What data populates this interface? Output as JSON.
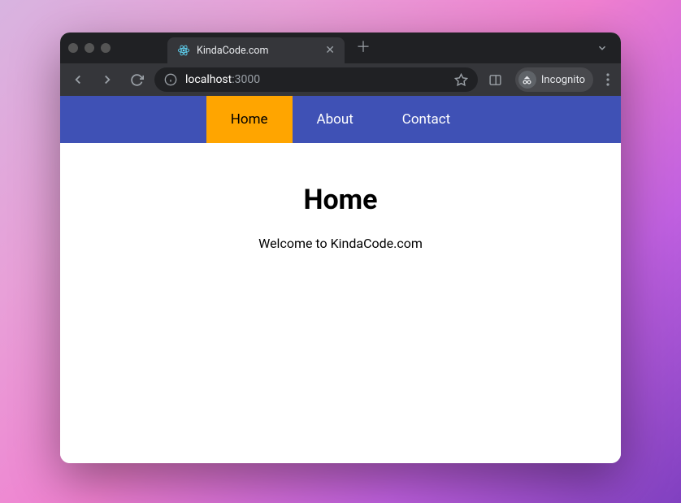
{
  "browser": {
    "tab_title": "KindaCode.com",
    "url_host": "localhost",
    "url_port": ":3000",
    "incognito_label": "Incognito"
  },
  "nav": {
    "items": [
      {
        "label": "Home",
        "active": true
      },
      {
        "label": "About",
        "active": false
      },
      {
        "label": "Contact",
        "active": false
      }
    ]
  },
  "page": {
    "heading": "Home",
    "welcome": "Welcome to KindaCode.com"
  },
  "colors": {
    "navbar_bg": "#3f51b5",
    "navbar_active_bg": "#ffa500"
  }
}
